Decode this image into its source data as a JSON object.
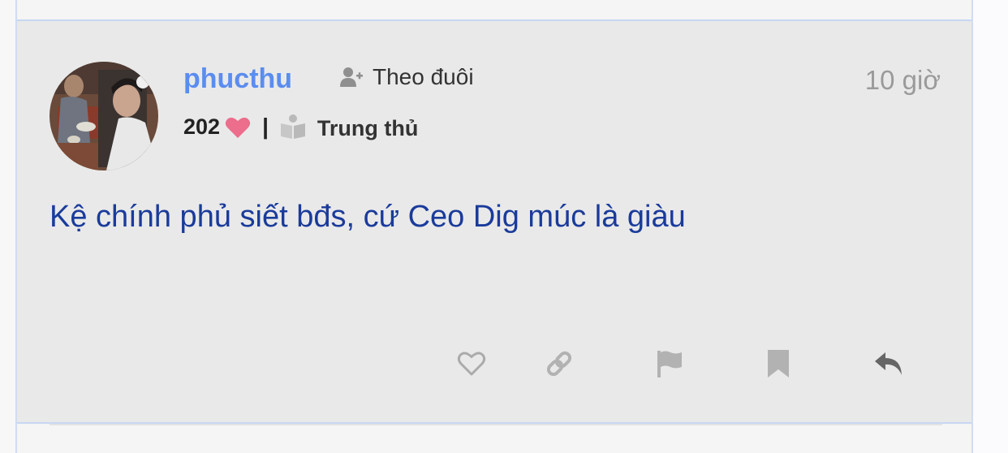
{
  "post": {
    "author": {
      "username": "phucthu",
      "avatar_icon": "user-avatar-photo",
      "likes": "202",
      "rank": "Trung thủ"
    },
    "follow_label": "Theo đuôi",
    "time": "10 giờ",
    "content": "Kệ chính phủ siết bđs, cứ Ceo Dig múc là giàu",
    "actions": [
      {
        "name": "like",
        "icon": "heart-outline-icon"
      },
      {
        "name": "copy-link",
        "icon": "link-icon"
      },
      {
        "name": "report",
        "icon": "flag-icon"
      },
      {
        "name": "bookmark",
        "icon": "bookmark-icon"
      },
      {
        "name": "reply",
        "icon": "reply-icon"
      }
    ]
  },
  "colors": {
    "username": "#5b8def",
    "content": "#1a3b9b",
    "heart": "#ec6d8c",
    "post_bg": "#e9e9e9",
    "border": "#c7d7f2"
  }
}
